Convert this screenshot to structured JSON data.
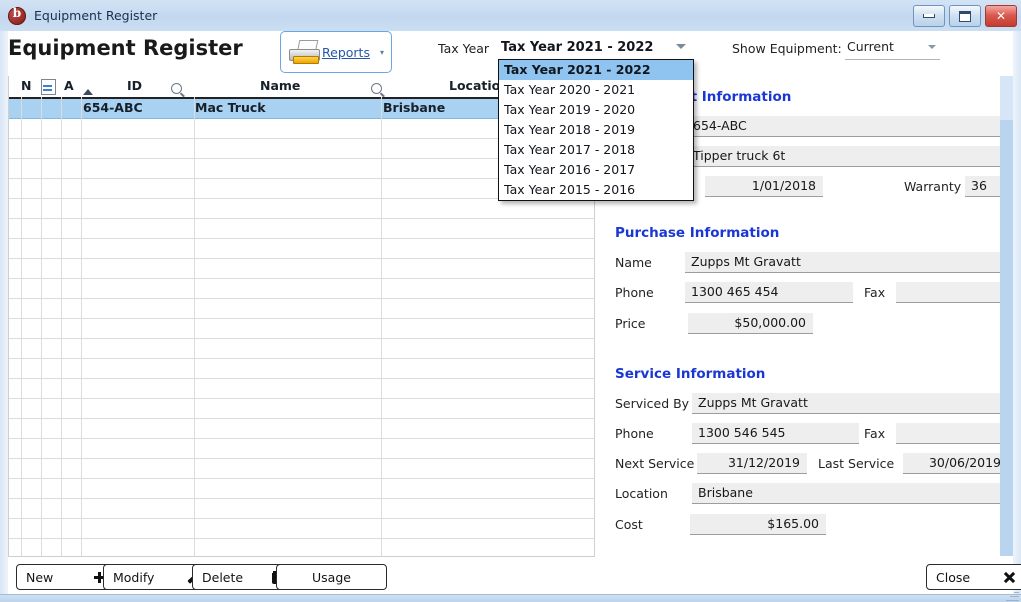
{
  "window": {
    "title": "Equipment Register",
    "icon": "app-icon",
    "controls": {
      "minimize": "–",
      "maximize": "❐",
      "close": "✕"
    }
  },
  "header": {
    "page_title": "Equipment Register",
    "reports_button": {
      "label": "Reports",
      "icon": "printer-icon",
      "arrow": "▾"
    },
    "tax_year_label": "Tax Year",
    "tax_year_value": "Tax Year 2021 - 2022",
    "show_equipment_label": "Show Equipment:",
    "show_equipment_value": "Current"
  },
  "dropdown": {
    "open": true,
    "selected_index": 0,
    "items": [
      "Tax Year 2021 - 2022",
      "Tax Year 2020 - 2021",
      "Tax Year 2019 - 2020",
      "Tax Year 2018 - 2019",
      "Tax Year 2017 - 2018",
      "Tax Year 2016 - 2017",
      "Tax Year 2015 - 2016"
    ]
  },
  "grid": {
    "columns": [
      "N",
      "A",
      "ID",
      "Name",
      "Location"
    ],
    "header": {
      "n": "N",
      "a": "A",
      "id": "ID",
      "name": "Name",
      "location": "Location"
    },
    "rows": [
      {
        "id": "654-ABC",
        "name": "Mac Truck",
        "location": "Brisbane",
        "selected": true
      }
    ],
    "empty_row_count": 23
  },
  "panel": {
    "equipment_section_title": "Equipment Information",
    "equipment": {
      "id_value": "654-ABC",
      "description_value": "Tipper truck 6t",
      "date_value": "1/01/2018",
      "warranty_label": "Warranty",
      "warranty_value": "36"
    },
    "purchase_section_title": "Purchase Information",
    "purchase": {
      "name_label": "Name",
      "name_value": "Zupps Mt Gravatt",
      "phone_label": "Phone",
      "phone_value": "1300 465 454",
      "fax_label": "Fax",
      "fax_value": "",
      "price_label": "Price",
      "price_value": "$50,000.00"
    },
    "service_section_title": "Service Information",
    "service": {
      "serviced_by_label": "Serviced By",
      "serviced_by_value": "Zupps Mt Gravatt",
      "phone_label": "Phone",
      "phone_value": "1300 546 545",
      "fax_label": "Fax",
      "fax_value": "",
      "next_service_label": "Next Service",
      "next_service_value": "31/12/2019",
      "last_service_label": "Last Service",
      "last_service_value": "30/06/2019",
      "location_label": "Location",
      "location_value": "Brisbane",
      "cost_label": "Cost",
      "cost_value": "$165.00"
    }
  },
  "footer": {
    "new_label": "New",
    "modify_label": "Modify",
    "delete_label": "Delete",
    "usage_label": "Usage",
    "close_label": "Close"
  },
  "colors": {
    "accent_blue": "#1a37d4",
    "selection_blue": "#a8d1f2",
    "dropdown_highlight": "#8fc3f0",
    "link_blue": "#2558a8"
  }
}
